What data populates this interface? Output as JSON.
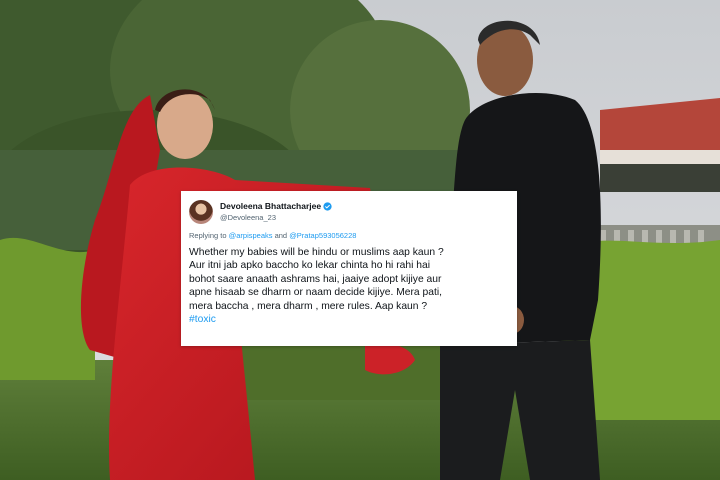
{
  "tweet": {
    "display_name": "Devoleena Bhattacharjee",
    "handle": "@Devoleena_23",
    "replying_prefix": "Replying to ",
    "reply_handle_1": "@arpispeaks",
    "reply_and": " and ",
    "reply_handle_2": "@Pratap593056228",
    "body_lines": [
      "Whether my babies will be hindu or muslims aap kaun ?",
      "Aur itni jab apko baccho ko lekar chinta ho hi rahi hai",
      "bohot saare anaath ashrams hai, jaaiye adopt kijiye aur",
      "apne hisaab se dharm or naam decide kijiye. Mera pati,",
      "mera baccha , mera dharm , mere rules. Aap kaun ?"
    ],
    "hashtag": "#toxic",
    "verified_icon": "verified-badge-icon",
    "link_color": "#1d9bf0"
  }
}
